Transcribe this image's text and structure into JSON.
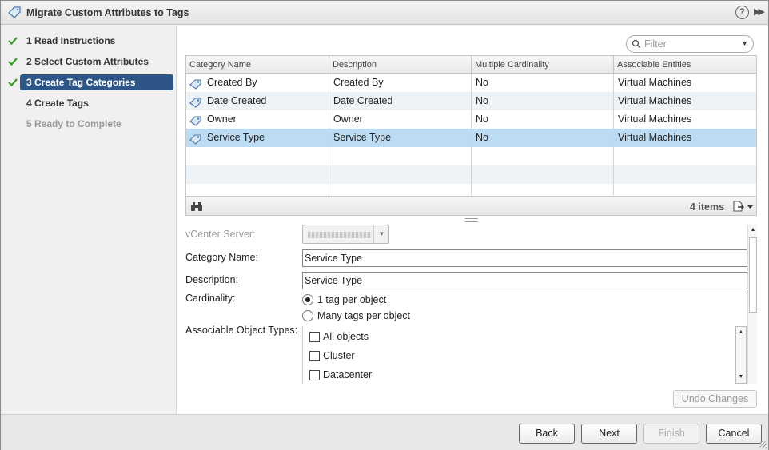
{
  "window": {
    "title": "Migrate Custom Attributes to Tags",
    "help_icon_text": "?"
  },
  "steps": [
    {
      "label": "1  Read Instructions",
      "state": "done"
    },
    {
      "label": "2  Select Custom Attributes",
      "state": "done"
    },
    {
      "label": "3  Create Tag Categories",
      "state": "active"
    },
    {
      "label": "4  Create Tags",
      "state": "pending"
    },
    {
      "label": "5  Ready to Complete",
      "state": "disabled"
    }
  ],
  "filter": {
    "placeholder": "Filter"
  },
  "grid": {
    "columns": [
      "Category Name",
      "Description",
      "Multiple Cardinality",
      "Associable Entities"
    ],
    "rows": [
      [
        "Created By",
        "Created By",
        "No",
        "Virtual Machines"
      ],
      [
        "Date Created",
        "Date Created",
        "No",
        "Virtual Machines"
      ],
      [
        "Owner",
        "Owner",
        "No",
        "Virtual Machines"
      ],
      [
        "Service Type",
        "Service Type",
        "No",
        "Virtual Machines"
      ]
    ],
    "selected_row": 3,
    "item_count": "4 items"
  },
  "form": {
    "vcenter_label": "vCenter Server:",
    "category_label": "Category Name:",
    "category_value": "Service Type",
    "description_label": "Description:",
    "description_value": "Service Type",
    "cardinality_label": "Cardinality:",
    "cardinality_options": [
      "1 tag per object",
      "Many tags per object"
    ],
    "cardinality_selected": 0,
    "object_types_label": "Associable Object Types:",
    "object_types": [
      "All objects",
      "Cluster",
      "Datacenter"
    ],
    "undo_label": "Undo Changes"
  },
  "buttons": {
    "back": "Back",
    "next": "Next",
    "finish": "Finish",
    "cancel": "Cancel"
  },
  "colors": {
    "active_step": "#2d5585",
    "selected_row": "#bcdcf4",
    "check": "#3a9a2a"
  }
}
